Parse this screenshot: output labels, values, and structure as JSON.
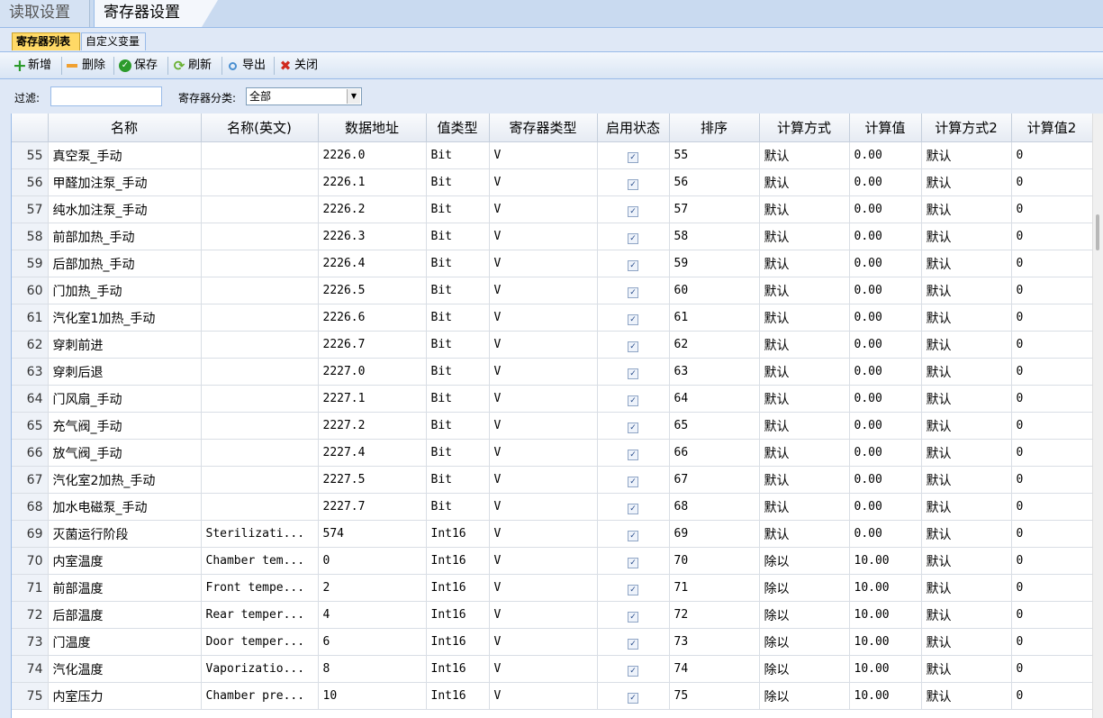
{
  "top_tabs": [
    "读取设置",
    "寄存器设置"
  ],
  "sub_tabs": [
    "寄存器列表",
    "自定义变量"
  ],
  "toolbar": {
    "add": "新增",
    "delete": "删除",
    "save": "保存",
    "refresh": "刷新",
    "export": "导出",
    "close": "关闭"
  },
  "filter": {
    "filter_label": "过滤:",
    "filter_value": "",
    "category_label": "寄存器分类:",
    "category_value": "全部"
  },
  "columns": [
    "",
    "名称",
    "名称(英文)",
    "数据地址",
    "值类型",
    "寄存器类型",
    "启用状态",
    "排序",
    "计算方式",
    "计算值",
    "计算方式2",
    "计算值2"
  ],
  "rows": [
    {
      "idx": "55",
      "name": "真空泵_手动",
      "en": "",
      "addr": "2226.0",
      "vtype": "Bit",
      "rtype": "V",
      "enabled": true,
      "order": "55",
      "calc": "默认",
      "cval": "0.00",
      "calc2": "默认",
      "cval2": "0"
    },
    {
      "idx": "56",
      "name": "甲醛加注泵_手动",
      "en": "",
      "addr": "2226.1",
      "vtype": "Bit",
      "rtype": "V",
      "enabled": true,
      "order": "56",
      "calc": "默认",
      "cval": "0.00",
      "calc2": "默认",
      "cval2": "0"
    },
    {
      "idx": "57",
      "name": "纯水加注泵_手动",
      "en": "",
      "addr": "2226.2",
      "vtype": "Bit",
      "rtype": "V",
      "enabled": true,
      "order": "57",
      "calc": "默认",
      "cval": "0.00",
      "calc2": "默认",
      "cval2": "0"
    },
    {
      "idx": "58",
      "name": "前部加热_手动",
      "en": "",
      "addr": "2226.3",
      "vtype": "Bit",
      "rtype": "V",
      "enabled": true,
      "order": "58",
      "calc": "默认",
      "cval": "0.00",
      "calc2": "默认",
      "cval2": "0"
    },
    {
      "idx": "59",
      "name": "后部加热_手动",
      "en": "",
      "addr": "2226.4",
      "vtype": "Bit",
      "rtype": "V",
      "enabled": true,
      "order": "59",
      "calc": "默认",
      "cval": "0.00",
      "calc2": "默认",
      "cval2": "0"
    },
    {
      "idx": "60",
      "name": "门加热_手动",
      "en": "",
      "addr": "2226.5",
      "vtype": "Bit",
      "rtype": "V",
      "enabled": true,
      "order": "60",
      "calc": "默认",
      "cval": "0.00",
      "calc2": "默认",
      "cval2": "0"
    },
    {
      "idx": "61",
      "name": "汽化室1加热_手动",
      "en": "",
      "addr": "2226.6",
      "vtype": "Bit",
      "rtype": "V",
      "enabled": true,
      "order": "61",
      "calc": "默认",
      "cval": "0.00",
      "calc2": "默认",
      "cval2": "0"
    },
    {
      "idx": "62",
      "name": "穿刺前进",
      "en": "",
      "addr": "2226.7",
      "vtype": "Bit",
      "rtype": "V",
      "enabled": true,
      "order": "62",
      "calc": "默认",
      "cval": "0.00",
      "calc2": "默认",
      "cval2": "0"
    },
    {
      "idx": "63",
      "name": "穿刺后退",
      "en": "",
      "addr": "2227.0",
      "vtype": "Bit",
      "rtype": "V",
      "enabled": true,
      "order": "63",
      "calc": "默认",
      "cval": "0.00",
      "calc2": "默认",
      "cval2": "0"
    },
    {
      "idx": "64",
      "name": "门风扇_手动",
      "en": "",
      "addr": "2227.1",
      "vtype": "Bit",
      "rtype": "V",
      "enabled": true,
      "order": "64",
      "calc": "默认",
      "cval": "0.00",
      "calc2": "默认",
      "cval2": "0"
    },
    {
      "idx": "65",
      "name": "充气阀_手动",
      "en": "",
      "addr": "2227.2",
      "vtype": "Bit",
      "rtype": "V",
      "enabled": true,
      "order": "65",
      "calc": "默认",
      "cval": "0.00",
      "calc2": "默认",
      "cval2": "0"
    },
    {
      "idx": "66",
      "name": "放气阀_手动",
      "en": "",
      "addr": "2227.4",
      "vtype": "Bit",
      "rtype": "V",
      "enabled": true,
      "order": "66",
      "calc": "默认",
      "cval": "0.00",
      "calc2": "默认",
      "cval2": "0"
    },
    {
      "idx": "67",
      "name": "汽化室2加热_手动",
      "en": "",
      "addr": "2227.5",
      "vtype": "Bit",
      "rtype": "V",
      "enabled": true,
      "order": "67",
      "calc": "默认",
      "cval": "0.00",
      "calc2": "默认",
      "cval2": "0"
    },
    {
      "idx": "68",
      "name": "加水电磁泵_手动",
      "en": "",
      "addr": "2227.7",
      "vtype": "Bit",
      "rtype": "V",
      "enabled": true,
      "order": "68",
      "calc": "默认",
      "cval": "0.00",
      "calc2": "默认",
      "cval2": "0"
    },
    {
      "idx": "69",
      "name": "灭菌运行阶段",
      "en": "Sterilizati...",
      "addr": "574",
      "vtype": "Int16",
      "rtype": "V",
      "enabled": true,
      "order": "69",
      "calc": "默认",
      "cval": "0.00",
      "calc2": "默认",
      "cval2": "0"
    },
    {
      "idx": "70",
      "name": "内室温度",
      "en": "Chamber tem...",
      "addr": "0",
      "vtype": "Int16",
      "rtype": "V",
      "enabled": true,
      "order": "70",
      "calc": "除以",
      "cval": "10.00",
      "calc2": "默认",
      "cval2": "0"
    },
    {
      "idx": "71",
      "name": "前部温度",
      "en": "Front tempe...",
      "addr": "2",
      "vtype": "Int16",
      "rtype": "V",
      "enabled": true,
      "order": "71",
      "calc": "除以",
      "cval": "10.00",
      "calc2": "默认",
      "cval2": "0"
    },
    {
      "idx": "72",
      "name": "后部温度",
      "en": "Rear temper...",
      "addr": "4",
      "vtype": "Int16",
      "rtype": "V",
      "enabled": true,
      "order": "72",
      "calc": "除以",
      "cval": "10.00",
      "calc2": "默认",
      "cval2": "0"
    },
    {
      "idx": "73",
      "name": "门温度",
      "en": "Door temper...",
      "addr": "6",
      "vtype": "Int16",
      "rtype": "V",
      "enabled": true,
      "order": "73",
      "calc": "除以",
      "cval": "10.00",
      "calc2": "默认",
      "cval2": "0"
    },
    {
      "idx": "74",
      "name": "汽化温度",
      "en": "Vaporizatio...",
      "addr": "8",
      "vtype": "Int16",
      "rtype": "V",
      "enabled": true,
      "order": "74",
      "calc": "除以",
      "cval": "10.00",
      "calc2": "默认",
      "cval2": "0"
    },
    {
      "idx": "75",
      "name": "内室压力",
      "en": "Chamber pre...",
      "addr": "10",
      "vtype": "Int16",
      "rtype": "V",
      "enabled": true,
      "order": "75",
      "calc": "除以",
      "cval": "10.00",
      "calc2": "默认",
      "cval2": "0"
    }
  ]
}
